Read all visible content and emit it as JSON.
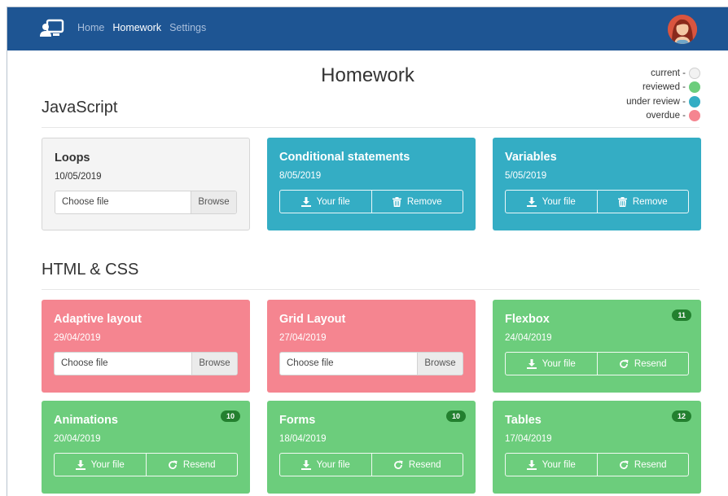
{
  "navbar": {
    "links": [
      "Home",
      "Homework",
      "Settings"
    ],
    "active": "Homework",
    "brand_icon": "monitor-user-icon",
    "avatar": "user-avatar"
  },
  "page": {
    "title": "Homework"
  },
  "legend": [
    {
      "label": "current -",
      "color": "#f2f2f2"
    },
    {
      "label": "reviewed -",
      "color": "#6ccd7c"
    },
    {
      "label": "under review -",
      "color": "#34adc4"
    },
    {
      "label": "overdue -",
      "color": "#f58590"
    }
  ],
  "sections": [
    {
      "title": "JavaScript",
      "cards": [
        {
          "title": "Loops",
          "date": "10/05/2019",
          "status": "current",
          "file_placeholder": "Choose file",
          "browse_label": "Browse"
        },
        {
          "title": "Conditional statements",
          "date": "8/05/2019",
          "status": "under-review",
          "btn1": "Your file",
          "btn2": "Remove"
        },
        {
          "title": "Variables",
          "date": "5/05/2019",
          "status": "under-review",
          "btn1": "Your file",
          "btn2": "Remove"
        }
      ]
    },
    {
      "title": "HTML & CSS",
      "cards": [
        {
          "title": "Adaptive layout",
          "date": "29/04/2019",
          "status": "overdue",
          "file_placeholder": "Choose file",
          "browse_label": "Browse"
        },
        {
          "title": "Grid Layout",
          "date": "27/04/2019",
          "status": "overdue",
          "file_placeholder": "Choose file",
          "browse_label": "Browse"
        },
        {
          "title": "Flexbox",
          "date": "24/04/2019",
          "status": "reviewed",
          "badge": "11",
          "btn1": "Your file",
          "btn2": "Resend"
        },
        {
          "title": "Animations",
          "date": "20/04/2019",
          "status": "reviewed",
          "badge": "10",
          "btn1": "Your file",
          "btn2": "Resend"
        },
        {
          "title": "Forms",
          "date": "18/04/2019",
          "status": "reviewed",
          "badge": "10",
          "btn1": "Your file",
          "btn2": "Resend"
        },
        {
          "title": "Tables",
          "date": "17/04/2019",
          "status": "reviewed",
          "badge": "12",
          "btn1": "Your file",
          "btn2": "Resend"
        }
      ]
    }
  ]
}
